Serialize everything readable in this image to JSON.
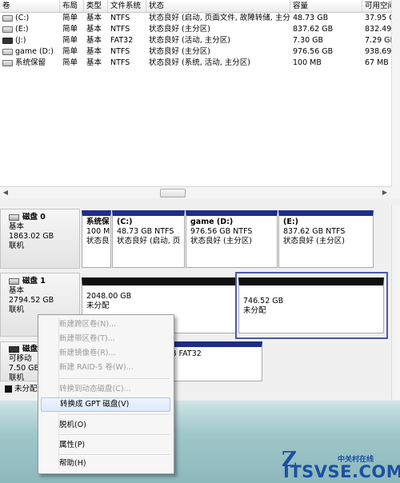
{
  "list": {
    "headers": [
      "卷",
      "布局",
      "类型",
      "文件系统",
      "状态",
      "容量",
      "可用空间"
    ],
    "rows": [
      {
        "name": "(C:)",
        "layout": "简单",
        "type": "基本",
        "fs": "NTFS",
        "status": "状态良好 (启动, 页面文件, 故障转储, 主分区)",
        "capacity": "48.73 GB",
        "free": "37.95 G",
        "icon": "drive-icon"
      },
      {
        "name": "(E:)",
        "layout": "简单",
        "type": "基本",
        "fs": "NTFS",
        "status": "状态良好 (主分区)",
        "capacity": "837.62 GB",
        "free": "832.49 G",
        "icon": "drive-icon"
      },
      {
        "name": "(J:)",
        "layout": "简单",
        "type": "基本",
        "fs": "FAT32",
        "status": "状态良好 (活动, 主分区)",
        "capacity": "7.30 GB",
        "free": "7.29 GB",
        "icon": "removable-drive-icon"
      },
      {
        "name": "game (D:)",
        "layout": "简单",
        "type": "基本",
        "fs": "NTFS",
        "status": "状态良好 (主分区)",
        "capacity": "976.56 GB",
        "free": "938.69 G",
        "icon": "drive-icon"
      },
      {
        "name": "系统保留",
        "layout": "简单",
        "type": "基本",
        "fs": "NTFS",
        "status": "状态良好 (系统, 活动, 主分区)",
        "capacity": "100 MB",
        "free": "67 MB",
        "icon": "drive-icon"
      }
    ]
  },
  "disks": [
    {
      "name": "磁盘 0",
      "type": "基本",
      "size": "1863.02 GB",
      "state": "联机",
      "partitions": [
        {
          "name": "系统保",
          "line1": "100 M",
          "line2": "状态良"
        },
        {
          "name": "(C:)",
          "line1": "48.73 GB NTFS",
          "line2": "状态良好 (启动, 页"
        },
        {
          "name": "game  (D:)",
          "line1": "976.56 GB NTFS",
          "line2": "状态良好 (主分区)"
        },
        {
          "name": "(E:)",
          "line1": "837.62 GB NTFS",
          "line2": "状态良好 (主分区)"
        }
      ]
    },
    {
      "name": "磁盘 1",
      "type": "基本",
      "size": "2794.52 GB",
      "state": "联机",
      "partitions": [
        {
          "line1": "2048.00 GB",
          "line2": "未分配"
        },
        {
          "line1": "746.52 GB",
          "line2": "未分配"
        }
      ]
    },
    {
      "name": "磁盘",
      "type": "可移动",
      "size": "7.50 GB",
      "state": "联机",
      "partitions": [
        {
          "line1": "B FAT32"
        }
      ]
    }
  ],
  "legend_unalloc": "未分配",
  "menu": {
    "items": [
      {
        "label": "新建跨区卷(N)...",
        "enabled": false
      },
      {
        "label": "新建带区卷(T)...",
        "enabled": false
      },
      {
        "label": "新建镜像卷(R)...",
        "enabled": false
      },
      {
        "label": "新建 RAID-5 卷(W)...",
        "enabled": false
      },
      {
        "label": "转换到动态磁盘(C)...",
        "enabled": false
      },
      {
        "label": "转换成 GPT 磁盘(V)",
        "enabled": true,
        "highlighted": true
      },
      {
        "label": "脱机(O)",
        "enabled": true
      },
      {
        "label": "属性(P)",
        "enabled": true
      },
      {
        "label": "帮助(H)",
        "enabled": true
      }
    ]
  },
  "watermark": {
    "cn": "中关村在线",
    "en": "ITSVSE.COM"
  },
  "colors": {
    "primary_partition": "#1e2c8c",
    "unallocated": "#111111",
    "selection": "#4a5aa8"
  }
}
